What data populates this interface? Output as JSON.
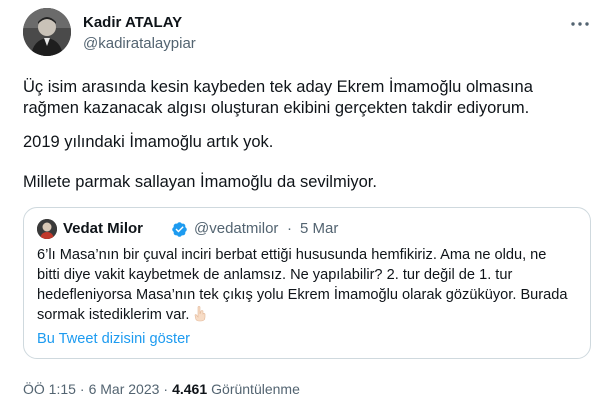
{
  "author": {
    "name": "Kadir ATALAY",
    "handle": "@kadiratalaypiar"
  },
  "tweet": {
    "paragraphs": [
      [
        "Üç isim arasında kesin kaybeden tek aday Ekrem İmamoğlu olmasına",
        "rağmen kazanacak algısı oluşturan ekibini gerçekten takdir ediyorum."
      ],
      [
        "2019 yılındaki İmamoğlu artık yok."
      ],
      [
        "Millete parmak sallayan İmamoğlu da sevilmiyor."
      ]
    ]
  },
  "quoted_tweet": {
    "name": "Vedat Milor",
    "handle": "@vedatmilor",
    "separator": "·",
    "date": "5 Mar",
    "verified_color": "#1d9bf0",
    "lines": [
      "6’lı Masa’nın bir çuval inciri berbat ettiği hususunda hemfikiriz. Ama ne oldu, ne",
      "bitti diye vakit kaybetmek de anlamsız. Ne yapılabilir? 2. tur değil de 1. tur",
      "hedefleniyorsa Masa’nın tek çıkış yolu Ekrem İmamoğlu olarak gözüküyor. Burada",
      "sormak istediklerim var."
    ],
    "emoji_icon": "pointing-down-hand-icon",
    "thread_link": "Bu Tweet dizisini göster"
  },
  "meta": {
    "time": "ÖÖ 1:15",
    "separator": "·",
    "date": "6 Mar 2023",
    "views_count": "4.461",
    "views_label": "Görüntülenme"
  },
  "icons": {
    "more": "more-dots-icon",
    "verified": "verified-badge-icon"
  },
  "colors": {
    "link": "#1d9bf0",
    "secondary_text": "#536471",
    "border": "#cfd9de"
  }
}
